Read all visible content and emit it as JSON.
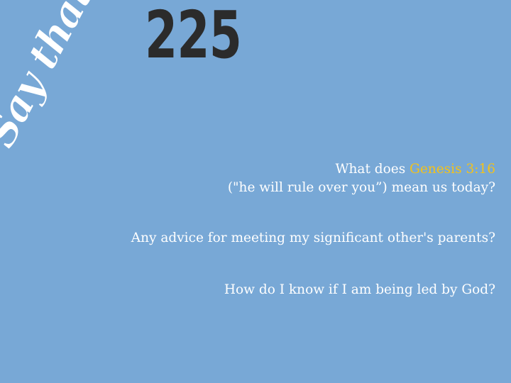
{
  "logo": {
    "text": "Say that!"
  },
  "episode": {
    "number": "225"
  },
  "questions": [
    {
      "line1_prefix": "What does ",
      "line1_highlight": "Genesis 3:16",
      "line2": "(\"he will rule over you”) mean us today?"
    },
    {
      "text": "Any advice for meeting my significant other's parents?"
    },
    {
      "text": "How do I know if I am being led by God?"
    }
  ],
  "colors": {
    "background": "#78a8d6",
    "highlight": "#f3c21a",
    "number": "#2b2b2b",
    "text": "#ffffff"
  }
}
